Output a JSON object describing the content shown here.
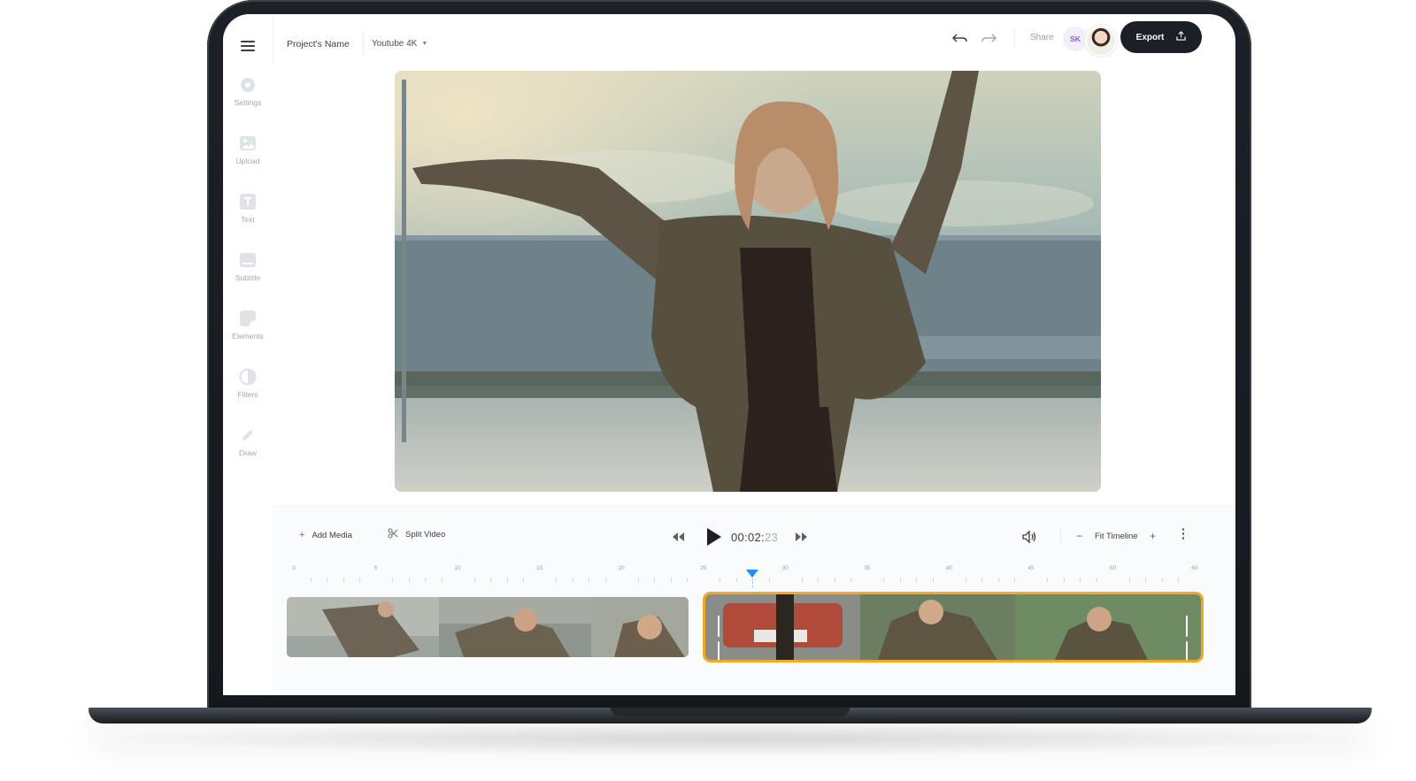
{
  "toolbar": {
    "project_name": "Project's Name",
    "format": "Youtube 4K",
    "share_label": "Share",
    "collaborator_initials": "SK",
    "export_label": "Export"
  },
  "sidebar": {
    "items": [
      {
        "label": "Settings",
        "icon": "gear-icon"
      },
      {
        "label": "Upload",
        "icon": "image-upload-icon"
      },
      {
        "label": "Text",
        "icon": "text-icon"
      },
      {
        "label": "Subtitle",
        "icon": "subtitle-icon"
      },
      {
        "label": "Elements",
        "icon": "elements-icon"
      },
      {
        "label": "Filters",
        "icon": "filter-icon"
      },
      {
        "label": "Draw",
        "icon": "pencil-icon"
      }
    ]
  },
  "controls": {
    "add_media_label": "Add Media",
    "split_video_label": "Split Video",
    "timecode_main": "00:02:",
    "timecode_frames": "23",
    "zoom_label": "Fit Timeline",
    "zoom_out_symbol": "−",
    "zoom_in_symbol": "+"
  },
  "timeline": {
    "ruler_labels": [
      "0",
      "5",
      "10",
      "15",
      "20",
      "25",
      "30",
      "35",
      "40",
      "45",
      "50",
      "60"
    ],
    "playhead_seconds": 28,
    "clips": [
      {
        "name": "clip-1",
        "selected": false
      },
      {
        "name": "clip-2",
        "selected": true
      }
    ]
  },
  "colors": {
    "accent": "#1f8ff0",
    "selection": "#f5a623",
    "export_bg": "#1b1f26",
    "collaborator": "#8b5fd6"
  }
}
